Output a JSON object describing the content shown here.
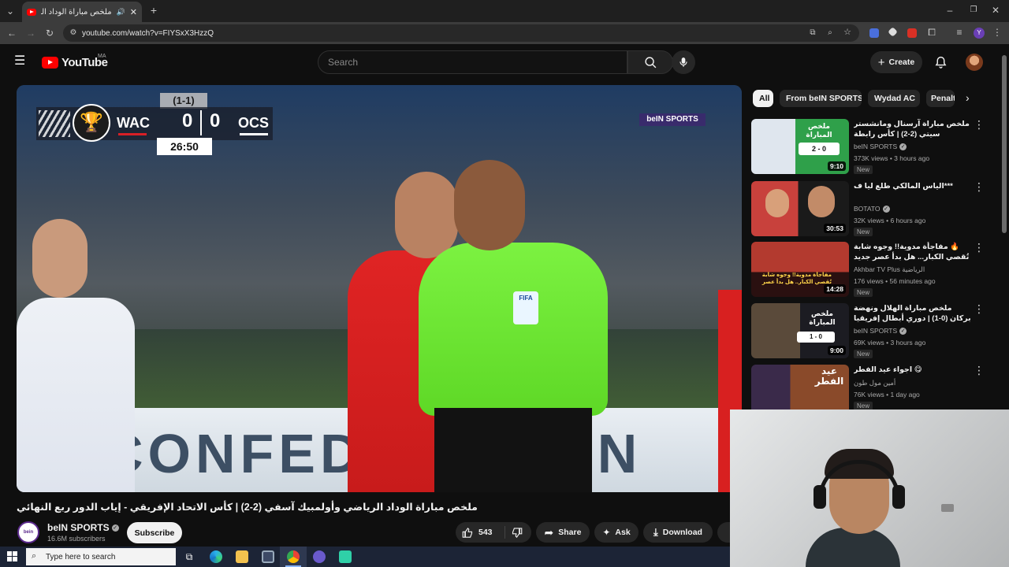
{
  "browser": {
    "tab_title": "ملخص مباراة الوداد الرياضي",
    "url": "youtube.com/watch?v=FIYSxX3HzzQ",
    "new_tab": "+",
    "profile_initial": "Y"
  },
  "header": {
    "logo_text": "YouTube",
    "region": "MA",
    "search_placeholder": "Search",
    "create_label": "Create"
  },
  "video": {
    "scoreboard": {
      "aggregate": "(1-1)",
      "home": "WAC",
      "home_score": "0",
      "away_score": "0",
      "away": "OCS",
      "clock": "26:50"
    },
    "broadcaster_logo": "beIN SPORTS",
    "banner_text": "CONFEDERATION",
    "title": "ملخص مباراة الوداد الرياضي وأولمبيك آسفي (2-2) | كأس الاتحاد الإفريقي - إياب الدور ربع النهائي"
  },
  "channel": {
    "name": "beIN SPORTS",
    "subscribers": "16.6M subscribers",
    "subscribe_label": "Subscribe"
  },
  "actions": {
    "likes": "543",
    "share": "Share",
    "ask": "Ask",
    "download": "Download"
  },
  "chips": [
    {
      "label": "All"
    },
    {
      "label": "From beIN SPORTS"
    },
    {
      "label": "Wydad AC"
    },
    {
      "label": "Penalty"
    }
  ],
  "recommendations": [
    {
      "title": "ملخص مباراة آرسنال ومانشستر سيتي (2-2) | كأس رابطة المحترفين - النهائي",
      "channel": "beIN SPORTS",
      "meta": "373K views • 3 hours ago",
      "badge": "New",
      "duration": "9:10",
      "thumb_text": "ملخص المباراة",
      "thumb_score": "2 - 0"
    },
    {
      "title": "***الياس المالكي طلع ليا ف",
      "channel": "BOTATO",
      "meta": "32K views • 6 hours ago",
      "badge": "New",
      "duration": "30:53"
    },
    {
      "title": "🔥 مفاجأة مدوية!! وجوه شابة تُقصي الكبار... هل بدأ عصر جديد للمنتخب؟ MA",
      "channel": "Akhbar TV Plus الرياضية",
      "meta": "176 views • 56 minutes ago",
      "badge": "New",
      "duration": "14:28",
      "thumb_text": "مفاجأة مدوية!! وجوه شابة تُقصي الكبار.. هل بدأ عصر جديد للمنتخب"
    },
    {
      "title": "ملخص مباراة الهلال ونهضة بركان (0-1) | دوري أبطال إفريقيا - إياب الدور ربع النهائي",
      "channel": "beIN SPORTS",
      "meta": "69K views • 3 hours ago",
      "badge": "New",
      "duration": "9:00",
      "thumb_text": "ملخص المباراة",
      "thumb_score": "1 - 0"
    },
    {
      "title": "😋 اجواء عيد الفطر",
      "channel": "أمين مول طون",
      "meta": "76K views • 1 day ago",
      "badge": "New",
      "thumb_text": "عيد الفطر"
    }
  ],
  "taskbar": {
    "search_placeholder": "Type here to search"
  }
}
